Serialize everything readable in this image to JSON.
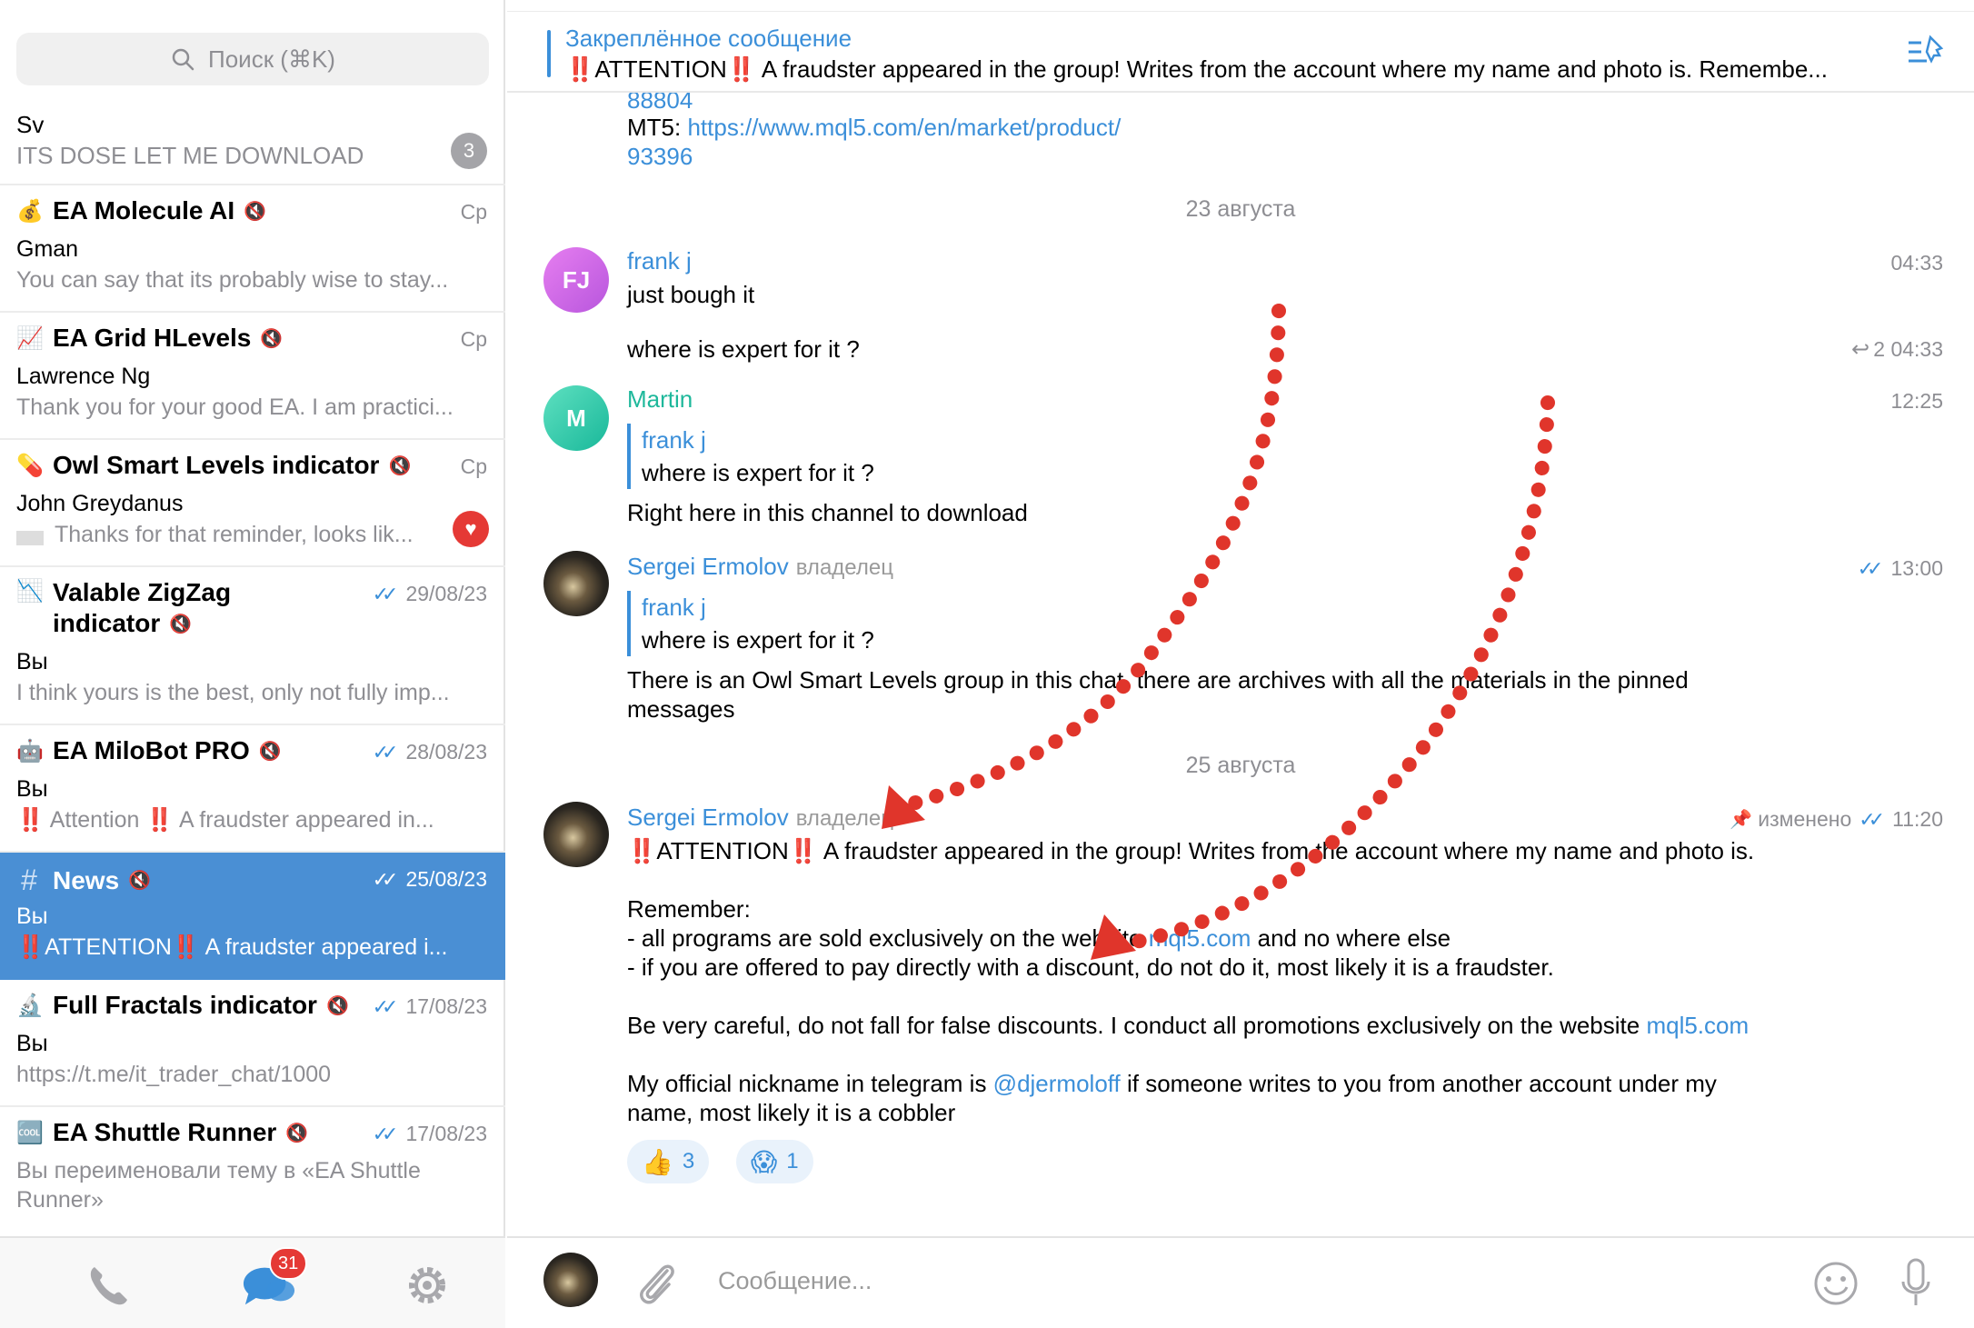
{
  "sidebar": {
    "search_placeholder": "Поиск (⌘K)",
    "chats": [
      {
        "title": "Sv",
        "preview": "ITS DOSE LET ME DOWNLOAD",
        "unread": "3"
      },
      {
        "icon": "money-bag-icon",
        "emoji": "💰",
        "title": "EA Molecule AI",
        "date": "Ср",
        "sender": "Gman",
        "preview": "You can say that its probably wise to stay..."
      },
      {
        "icon": "chart-icon",
        "emoji": "📈",
        "title": "EA Grid HLevels",
        "date": "Ср",
        "sender": "Lawrence Ng",
        "preview": "Thank you for your good EA. I am practici..."
      },
      {
        "icon": "pill-icon",
        "emoji": "💊",
        "title": "Owl Smart Levels indicator",
        "date": "Ср",
        "sender": "John Greydanus",
        "preview": "Thanks for that reminder, looks lik..."
      },
      {
        "icon": "chart-down-icon",
        "emoji": "📉",
        "title": "Valable ZigZag",
        "title2": "indicator",
        "date": "29/08/23",
        "sender": "Вы",
        "preview": "I think yours is the best, only not fully imp..."
      },
      {
        "icon": "robot-icon",
        "emoji": "🤖",
        "title": "EA MiloBot PRO",
        "date": "28/08/23",
        "sender": "Вы",
        "preview": "‼️ Attention ‼️ A fraudster appeared in..."
      },
      {
        "icon": "hash-icon",
        "emoji": "#",
        "title": "News",
        "date": "25/08/23",
        "sender": "Вы",
        "preview": "‼️ATTENTION‼️ A fraudster appeared i..."
      },
      {
        "icon": "microscope-icon",
        "emoji": "🔬",
        "title": "Full Fractals indicator",
        "date": "17/08/23",
        "sender": "Вы",
        "preview": "https://t.me/it_trader_chat/1000"
      },
      {
        "icon": "cool-icon",
        "emoji": "🆒",
        "title": "EA Shuttle Runner",
        "date": "17/08/23",
        "preview": "Вы переименовали тему в «EA Shuttle",
        "preview2": "Runner»"
      }
    ],
    "tabs_badge": "31"
  },
  "pinned": {
    "title": "Закреплённое сообщение",
    "text": "‼️ATTENTION‼️ A fraudster appeared in the group! Writes from the account where my name and photo is.  Remembe..."
  },
  "feed": {
    "top_partial": {
      "line1": "88804",
      "mt5_label": "MT5: ",
      "mt5_link": "https://www.mql5.com/en/market/product/",
      "line3": "93396"
    },
    "date1": "23 августа",
    "msg_frank": {
      "initials": "FJ",
      "name": "frank j",
      "time": "04:33",
      "text1": "just bough it",
      "text2": "where is expert for it ?",
      "replies": "2",
      "time2": "04:33"
    },
    "msg_martin": {
      "initials": "M",
      "name": "Martin",
      "time": "12:25",
      "quote_name": "frank j",
      "quote_text": "where is expert for it ?",
      "text": "Right here in this channel to download"
    },
    "msg_sergei1": {
      "name": "Sergei Ermolov",
      "role": "владелец",
      "time": "13:00",
      "quote_name": "frank j",
      "quote_text": "where is expert for it ?",
      "text1": "There is an Owl Smart Levels group in this chat, there are archives with all the materials in the pinned",
      "text2": "messages"
    },
    "date2": "25 августа",
    "msg_sergei2": {
      "name": "Sergei Ermolov",
      "role": "владелец",
      "edited": "изменено",
      "time": "11:20",
      "line1": "‼️ATTENTION‼️  A fraudster appeared in the group! Writes from the account where my name and photo is.",
      "line2": "Remember:",
      "line3a": "- all programs are sold exclusively on the website ",
      "line3link": "mql5.com",
      "line3b": " and no where else",
      "line4": "- if you are offered to pay directly with a discount, do not do it, most likely it is a fraudster.",
      "line5a": "Be very careful, do not fall for false discounts. I conduct all promotions exclusively on the website ",
      "line5link": "mql5.com",
      "line6a": "My official nickname in telegram is ",
      "line6link": "@djermoloff",
      "line6b": " if someone writes to you from another account under my",
      "line7": "name, most likely it is a cobbler",
      "reactions": [
        {
          "emoji": "👍",
          "count": "3"
        },
        {
          "emoji": "😱",
          "count": "1"
        }
      ]
    }
  },
  "composer": {
    "placeholder": "Сообщение..."
  },
  "colors": {
    "accent": "#3b8fd9",
    "active": "#4a8fd4",
    "annotation": "#e0352b"
  }
}
